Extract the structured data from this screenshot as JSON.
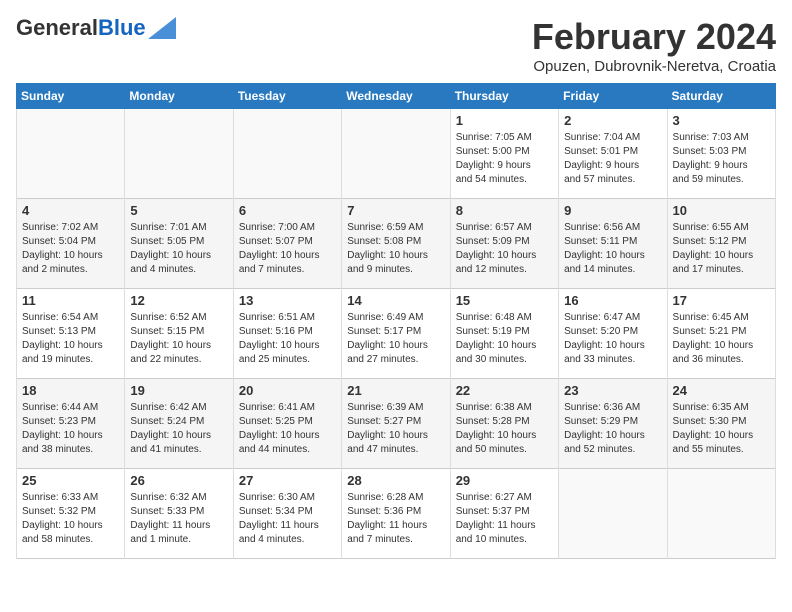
{
  "header": {
    "logo_general": "General",
    "logo_blue": "Blue",
    "month_title": "February 2024",
    "subtitle": "Opuzen, Dubrovnik-Neretva, Croatia"
  },
  "days_of_week": [
    "Sunday",
    "Monday",
    "Tuesday",
    "Wednesday",
    "Thursday",
    "Friday",
    "Saturday"
  ],
  "weeks": [
    {
      "days": [
        {
          "number": "",
          "info": ""
        },
        {
          "number": "",
          "info": ""
        },
        {
          "number": "",
          "info": ""
        },
        {
          "number": "",
          "info": ""
        },
        {
          "number": "1",
          "info": "Sunrise: 7:05 AM\nSunset: 5:00 PM\nDaylight: 9 hours\nand 54 minutes."
        },
        {
          "number": "2",
          "info": "Sunrise: 7:04 AM\nSunset: 5:01 PM\nDaylight: 9 hours\nand 57 minutes."
        },
        {
          "number": "3",
          "info": "Sunrise: 7:03 AM\nSunset: 5:03 PM\nDaylight: 9 hours\nand 59 minutes."
        }
      ]
    },
    {
      "days": [
        {
          "number": "4",
          "info": "Sunrise: 7:02 AM\nSunset: 5:04 PM\nDaylight: 10 hours\nand 2 minutes."
        },
        {
          "number": "5",
          "info": "Sunrise: 7:01 AM\nSunset: 5:05 PM\nDaylight: 10 hours\nand 4 minutes."
        },
        {
          "number": "6",
          "info": "Sunrise: 7:00 AM\nSunset: 5:07 PM\nDaylight: 10 hours\nand 7 minutes."
        },
        {
          "number": "7",
          "info": "Sunrise: 6:59 AM\nSunset: 5:08 PM\nDaylight: 10 hours\nand 9 minutes."
        },
        {
          "number": "8",
          "info": "Sunrise: 6:57 AM\nSunset: 5:09 PM\nDaylight: 10 hours\nand 12 minutes."
        },
        {
          "number": "9",
          "info": "Sunrise: 6:56 AM\nSunset: 5:11 PM\nDaylight: 10 hours\nand 14 minutes."
        },
        {
          "number": "10",
          "info": "Sunrise: 6:55 AM\nSunset: 5:12 PM\nDaylight: 10 hours\nand 17 minutes."
        }
      ]
    },
    {
      "days": [
        {
          "number": "11",
          "info": "Sunrise: 6:54 AM\nSunset: 5:13 PM\nDaylight: 10 hours\nand 19 minutes."
        },
        {
          "number": "12",
          "info": "Sunrise: 6:52 AM\nSunset: 5:15 PM\nDaylight: 10 hours\nand 22 minutes."
        },
        {
          "number": "13",
          "info": "Sunrise: 6:51 AM\nSunset: 5:16 PM\nDaylight: 10 hours\nand 25 minutes."
        },
        {
          "number": "14",
          "info": "Sunrise: 6:49 AM\nSunset: 5:17 PM\nDaylight: 10 hours\nand 27 minutes."
        },
        {
          "number": "15",
          "info": "Sunrise: 6:48 AM\nSunset: 5:19 PM\nDaylight: 10 hours\nand 30 minutes."
        },
        {
          "number": "16",
          "info": "Sunrise: 6:47 AM\nSunset: 5:20 PM\nDaylight: 10 hours\nand 33 minutes."
        },
        {
          "number": "17",
          "info": "Sunrise: 6:45 AM\nSunset: 5:21 PM\nDaylight: 10 hours\nand 36 minutes."
        }
      ]
    },
    {
      "days": [
        {
          "number": "18",
          "info": "Sunrise: 6:44 AM\nSunset: 5:23 PM\nDaylight: 10 hours\nand 38 minutes."
        },
        {
          "number": "19",
          "info": "Sunrise: 6:42 AM\nSunset: 5:24 PM\nDaylight: 10 hours\nand 41 minutes."
        },
        {
          "number": "20",
          "info": "Sunrise: 6:41 AM\nSunset: 5:25 PM\nDaylight: 10 hours\nand 44 minutes."
        },
        {
          "number": "21",
          "info": "Sunrise: 6:39 AM\nSunset: 5:27 PM\nDaylight: 10 hours\nand 47 minutes."
        },
        {
          "number": "22",
          "info": "Sunrise: 6:38 AM\nSunset: 5:28 PM\nDaylight: 10 hours\nand 50 minutes."
        },
        {
          "number": "23",
          "info": "Sunrise: 6:36 AM\nSunset: 5:29 PM\nDaylight: 10 hours\nand 52 minutes."
        },
        {
          "number": "24",
          "info": "Sunrise: 6:35 AM\nSunset: 5:30 PM\nDaylight: 10 hours\nand 55 minutes."
        }
      ]
    },
    {
      "days": [
        {
          "number": "25",
          "info": "Sunrise: 6:33 AM\nSunset: 5:32 PM\nDaylight: 10 hours\nand 58 minutes."
        },
        {
          "number": "26",
          "info": "Sunrise: 6:32 AM\nSunset: 5:33 PM\nDaylight: 11 hours\nand 1 minute."
        },
        {
          "number": "27",
          "info": "Sunrise: 6:30 AM\nSunset: 5:34 PM\nDaylight: 11 hours\nand 4 minutes."
        },
        {
          "number": "28",
          "info": "Sunrise: 6:28 AM\nSunset: 5:36 PM\nDaylight: 11 hours\nand 7 minutes."
        },
        {
          "number": "29",
          "info": "Sunrise: 6:27 AM\nSunset: 5:37 PM\nDaylight: 11 hours\nand 10 minutes."
        },
        {
          "number": "",
          "info": ""
        },
        {
          "number": "",
          "info": ""
        }
      ]
    }
  ]
}
